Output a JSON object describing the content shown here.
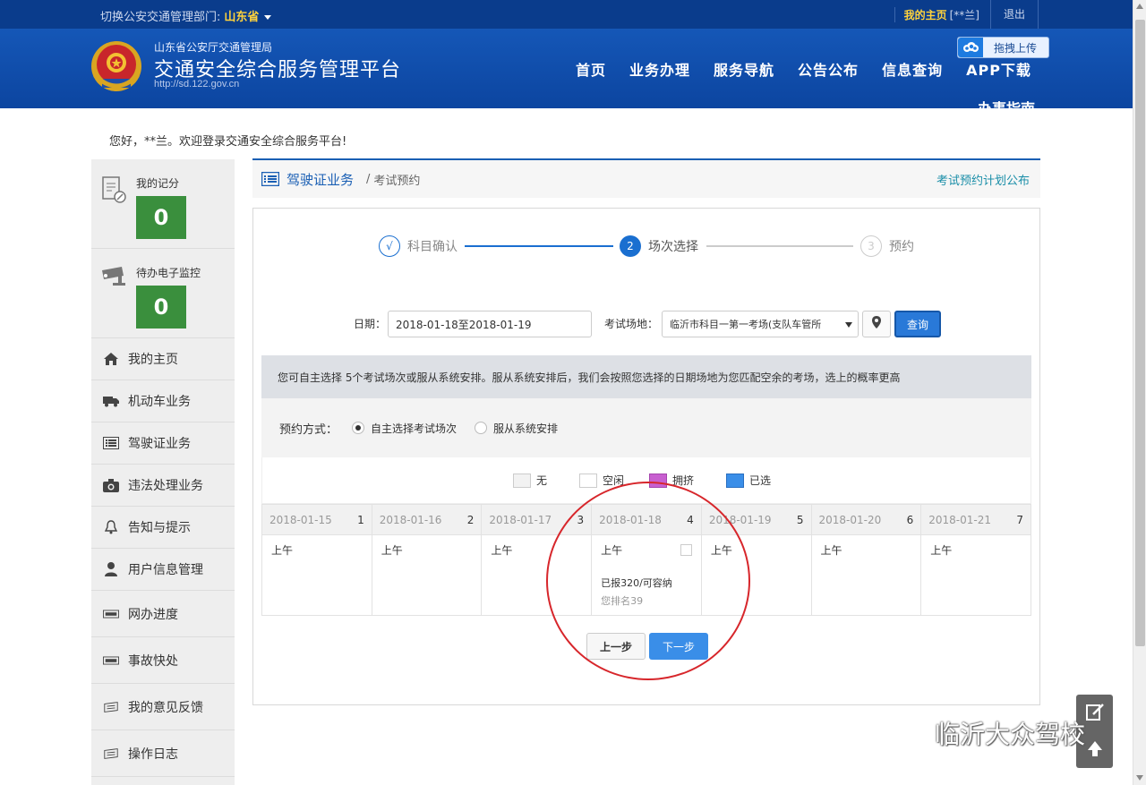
{
  "topbar": {
    "switch_label": "切换公安交通管理部门:",
    "province": "山东省",
    "my_home": "我的主页",
    "user": "[**兰]",
    "logout": "退出"
  },
  "header": {
    "dept": "山东省公安厅交通管理局",
    "platform": "交通安全综合服务管理平台",
    "site": "http://sd.122.gov.cn",
    "upload": "拖拽上传",
    "nav": [
      "首页",
      "业务办理",
      "服务导航",
      "公告公布",
      "信息查询",
      "APP下载"
    ],
    "nav_extra": "办事指南"
  },
  "greeting": "您好，**兰。欢迎登录交通安全综合服务平台!",
  "sidebar": {
    "score_label": "我的记分",
    "score_value": "0",
    "monitor_label": "待办电子监控",
    "monitor_value": "0",
    "items": [
      {
        "label": "我的主页",
        "icon": "home-icon"
      },
      {
        "label": "机动车业务",
        "icon": "truck-icon"
      },
      {
        "label": "驾驶证业务",
        "icon": "list-icon"
      },
      {
        "label": "违法处理业务",
        "icon": "camera-icon"
      },
      {
        "label": "告知与提示",
        "icon": "bell-icon"
      },
      {
        "label": "用户信息管理",
        "icon": "user-icon"
      },
      {
        "label": "网办进度",
        "icon": "progress-icon"
      },
      {
        "label": "事故快处",
        "icon": "accident-icon"
      },
      {
        "label": "我的意见反馈",
        "icon": "feedback-icon"
      },
      {
        "label": "操作日志",
        "icon": "log-icon"
      }
    ]
  },
  "breadcrumb": {
    "section": "驾驶证业务",
    "separator": "/",
    "page": "考试预约",
    "plan_link": "考试预约计划公布"
  },
  "steps": [
    {
      "mark": "√",
      "label": "科目确认",
      "state": "done"
    },
    {
      "mark": "2",
      "label": "场次选择",
      "state": "active"
    },
    {
      "mark": "3",
      "label": "预约",
      "state": "todo"
    }
  ],
  "filters": {
    "date_label": "日期：",
    "date_value": "2018-01-18至2018-01-19",
    "site_label": "考试场地：",
    "site_value": "临沂市科目一第一考场(支队车管所",
    "query_button": "查询"
  },
  "notice": "您可自主选择 5个考试场次或服从系统安排。服从系统安排后，我们会按照您选择的日期场地为您匹配空余的考场，选上的概率更高",
  "mode": {
    "label": "预约方式：",
    "options": [
      {
        "label": "自主选择考试场次",
        "selected": true
      },
      {
        "label": "服从系统安排",
        "selected": false
      }
    ]
  },
  "legend": [
    {
      "label": "无",
      "color": "#f2f2f2"
    },
    {
      "label": "空闲",
      "color": "#ffffff"
    },
    {
      "label": "拥挤",
      "color": "#c85fd0"
    },
    {
      "label": "已选",
      "color": "#3a8ee8"
    }
  ],
  "calendar": {
    "days": [
      {
        "date": "2018-01-15",
        "num": "1",
        "slot": "上午"
      },
      {
        "date": "2018-01-16",
        "num": "2",
        "slot": "上午"
      },
      {
        "date": "2018-01-17",
        "num": "3",
        "slot": "上午"
      },
      {
        "date": "2018-01-18",
        "num": "4",
        "slot": "上午",
        "info": "已报320/可容纳",
        "rank": "您排名39"
      },
      {
        "date": "2018-01-19",
        "num": "5",
        "slot": "上午"
      },
      {
        "date": "2018-01-20",
        "num": "6",
        "slot": "上午"
      },
      {
        "date": "2018-01-21",
        "num": "7",
        "slot": "上午"
      }
    ]
  },
  "buttons": {
    "prev": "上一步",
    "next": "下一步"
  },
  "watermark": "临沂大众驾校"
}
